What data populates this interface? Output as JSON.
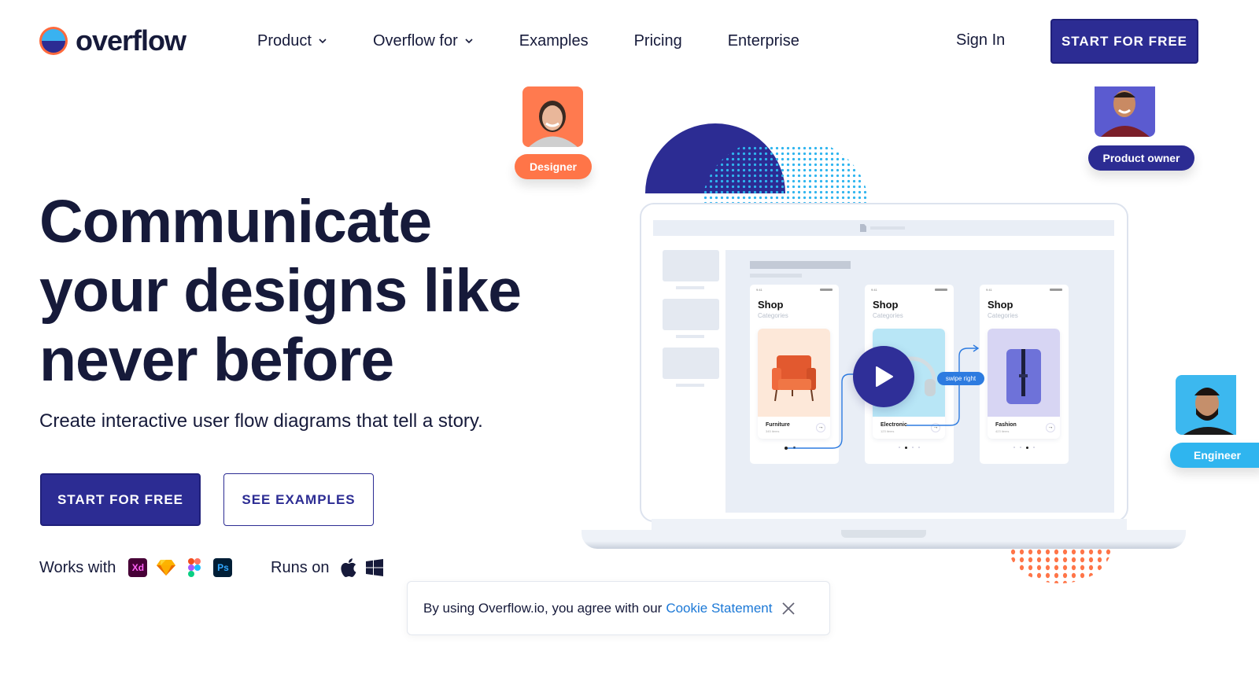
{
  "brand": {
    "name": "overflow",
    "colors": {
      "navy": "#2c2c93",
      "ink": "#161a3a",
      "orange": "#ff7548",
      "sky": "#2fb5ef",
      "link": "#1b78d6"
    }
  },
  "nav": {
    "links": [
      {
        "label": "Product",
        "icon": "chevron-down-icon"
      },
      {
        "label": "Overflow for",
        "icon": "chevron-down-icon"
      },
      {
        "label": "Examples"
      },
      {
        "label": "Pricing"
      },
      {
        "label": "Enterprise"
      }
    ],
    "sign_in": "Sign In",
    "cta": "START FOR FREE"
  },
  "hero": {
    "headline_lines": [
      "Communicate",
      "your designs like",
      "never before"
    ],
    "subhead": "Create interactive user flow diagrams that tell a story.",
    "primary_cta": "START FOR FREE",
    "secondary_cta": "SEE EXAMPLES",
    "works_with_label": "Works with",
    "works_with": [
      {
        "name": "Adobe XD",
        "glyph": "Xd",
        "icon": "adobe-xd-icon"
      },
      {
        "name": "Sketch",
        "icon": "sketch-icon"
      },
      {
        "name": "Figma",
        "icon": "figma-icon"
      },
      {
        "name": "Photoshop",
        "glyph": "Ps",
        "icon": "photoshop-icon"
      }
    ],
    "runs_on_label": "Runs on",
    "runs_on": [
      {
        "name": "macOS",
        "icon": "apple-icon"
      },
      {
        "name": "Windows",
        "icon": "windows-icon"
      }
    ]
  },
  "illustration": {
    "phones": [
      {
        "status_time": "9:41",
        "title": "Shop",
        "subtitle": "Categories",
        "category": "Furniture",
        "count": "345 items",
        "arrow": "→",
        "image": "armchair"
      },
      {
        "status_time": "9:41",
        "title": "Shop",
        "subtitle": "Categories",
        "category": "Electronic",
        "count": "123 items",
        "arrow": "→",
        "image": "headphones"
      },
      {
        "status_time": "9:41",
        "title": "Shop",
        "subtitle": "Categories",
        "category": "Fashion",
        "count": "423 items",
        "arrow": "→",
        "image": "backpack"
      }
    ],
    "swipe_label": "swipe right",
    "personas": [
      {
        "role": "Designer",
        "color": "#ff7548"
      },
      {
        "role": "Product owner",
        "color": "#2c2c93"
      },
      {
        "role": "Engineer",
        "color": "#2fb5ef"
      }
    ]
  },
  "cookie": {
    "text": "By using Overflow.io, you agree with our",
    "link": "Cookie Statement"
  }
}
